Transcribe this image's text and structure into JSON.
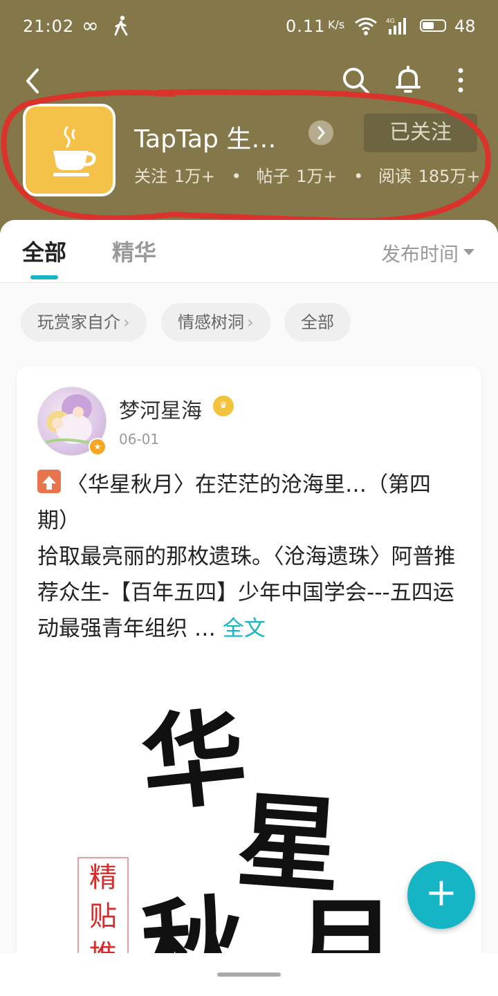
{
  "status_bar": {
    "time": "21:02",
    "net_speed": "0.11",
    "speed_unit": "K/s",
    "network": "4G",
    "battery": "48"
  },
  "header": {
    "app_title": "TapTap 生…",
    "follow_label": "已关注",
    "stats": {
      "follow_label": "关注",
      "follow_value": "1万+",
      "posts_label": "帖子",
      "posts_value": "1万+",
      "reads_label": "阅读",
      "reads_value": "185万+",
      "separator": "•"
    },
    "theme_color": "#84774a"
  },
  "tabs": {
    "all": "全部",
    "essence": "精华",
    "sort_label": "发布时间",
    "accent": "#15b5c5"
  },
  "chips": [
    {
      "label": "玩赏家自介",
      "arrow": "›"
    },
    {
      "label": "情感树洞",
      "arrow": "›"
    },
    {
      "label": "全部",
      "arrow": ""
    }
  ],
  "post": {
    "author": "梦河星海",
    "date": "06-01",
    "title": "〈华星秋月〉在茫茫的沧海里…（第四期）",
    "body": "拾取最亮丽的那枚遗珠。〈沧海遗珠〉阿普推荐众生-【百年五四】少年中国学会---五四运动最强青年组织 …",
    "more": "全文",
    "image": {
      "char1": "华",
      "char2": "星",
      "char3": "秋",
      "char4": "月",
      "stamp": "精贴推"
    }
  },
  "fab": {
    "label": "+"
  }
}
